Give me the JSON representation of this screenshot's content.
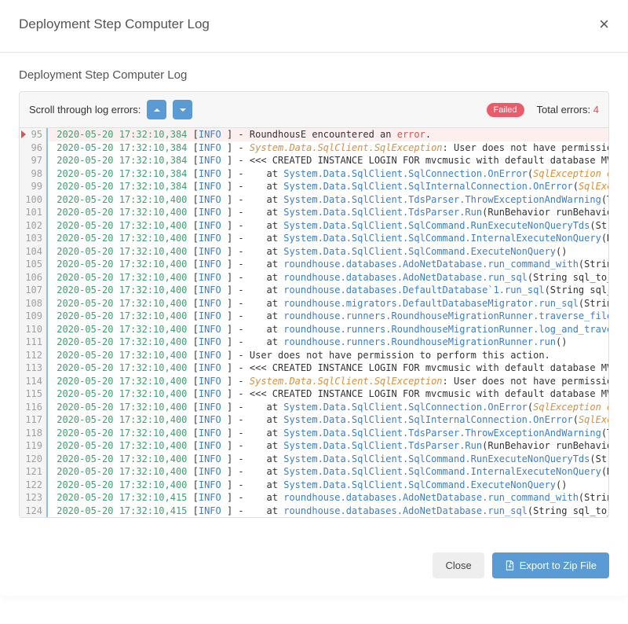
{
  "modal": {
    "title": "Deployment Step Computer Log",
    "close_icon": "×"
  },
  "section": {
    "title": "Deployment Step Computer Log"
  },
  "toolbar": {
    "scroll_label": "Scroll through log errors:",
    "status_badge": "Failed",
    "total_label": "Total errors: ",
    "total_count": "4"
  },
  "footer": {
    "close_label": "Close",
    "export_label": "Export to Zip File"
  },
  "log": {
    "first_line_no": 95,
    "lines": [
      {
        "ts": "2020-05-20 17:32:10,384",
        "lvl": "INFO",
        "msg_parts": [
          [
            "plain",
            " ] - RoundhousE encountered an "
          ],
          [
            "err",
            "error"
          ],
          [
            "plain",
            "."
          ]
        ],
        "current": true
      },
      {
        "ts": "2020-05-20 17:32:10,384",
        "lvl": "INFO",
        "msg_parts": [
          [
            "plain",
            " ] - "
          ],
          [
            "exc",
            "System.Data.SqlClient.SqlException"
          ],
          [
            "plain",
            ": User does not have permission "
          ]
        ]
      },
      {
        "ts": "2020-05-20 17:32:10,384",
        "lvl": "INFO",
        "msg_parts": [
          [
            "plain",
            " ] - <<< CREATED INSTANCE LOGIN FOR mvcmusic with default database MVCM"
          ]
        ]
      },
      {
        "ts": "2020-05-20 17:32:10,384",
        "lvl": "INFO",
        "msg_parts": [
          [
            "plain",
            " ] -    at "
          ],
          [
            "sys",
            "System.Data.SqlClient.SqlConnection.OnError"
          ],
          [
            "plain",
            "("
          ],
          [
            "exc",
            "SqlException exc"
          ]
        ]
      },
      {
        "ts": "2020-05-20 17:32:10,384",
        "lvl": "INFO",
        "msg_parts": [
          [
            "plain",
            " ] -    at "
          ],
          [
            "sys",
            "System.Data.SqlClient.SqlInternalConnection.OnError"
          ],
          [
            "plain",
            "("
          ],
          [
            "exc",
            "SqlExcep"
          ]
        ]
      },
      {
        "ts": "2020-05-20 17:32:10,400",
        "lvl": "INFO",
        "msg_parts": [
          [
            "plain",
            " ] -    at "
          ],
          [
            "sys",
            "System.Data.SqlClient.TdsParser.ThrowExceptionAndWarning"
          ],
          [
            "plain",
            "(Tds"
          ]
        ]
      },
      {
        "ts": "2020-05-20 17:32:10,400",
        "lvl": "INFO",
        "msg_parts": [
          [
            "plain",
            " ] -    at "
          ],
          [
            "sys",
            "System.Data.SqlClient.TdsParser.Run"
          ],
          [
            "plain",
            "(RunBehavior runBehavior,"
          ]
        ]
      },
      {
        "ts": "2020-05-20 17:32:10,400",
        "lvl": "INFO",
        "msg_parts": [
          [
            "plain",
            " ] -    at "
          ],
          [
            "sys",
            "System.Data.SqlClient.SqlCommand.RunExecuteNonQueryTds"
          ],
          [
            "plain",
            "(Strin"
          ]
        ]
      },
      {
        "ts": "2020-05-20 17:32:10,400",
        "lvl": "INFO",
        "msg_parts": [
          [
            "plain",
            " ] -    at "
          ],
          [
            "sys",
            "System.Data.SqlClient.SqlCommand.InternalExecuteNonQuery"
          ],
          [
            "plain",
            "(DbA"
          ]
        ]
      },
      {
        "ts": "2020-05-20 17:32:10,400",
        "lvl": "INFO",
        "msg_parts": [
          [
            "plain",
            " ] -    at "
          ],
          [
            "sys",
            "System.Data.SqlClient.SqlCommand.ExecuteNonQuery"
          ],
          [
            "plain",
            "()"
          ]
        ]
      },
      {
        "ts": "2020-05-20 17:32:10,400",
        "lvl": "INFO",
        "msg_parts": [
          [
            "plain",
            " ] -    at "
          ],
          [
            "sys",
            "roundhouse.databases.AdoNetDatabase.run_command_with"
          ],
          [
            "plain",
            "(String "
          ]
        ]
      },
      {
        "ts": "2020-05-20 17:32:10,400",
        "lvl": "INFO",
        "msg_parts": [
          [
            "plain",
            " ] -    at "
          ],
          [
            "sys",
            "roundhouse.databases.AdoNetDatabase.run_sql"
          ],
          [
            "plain",
            "(String sql_to_ru"
          ]
        ]
      },
      {
        "ts": "2020-05-20 17:32:10,400",
        "lvl": "INFO",
        "msg_parts": [
          [
            "plain",
            " ] -    at "
          ],
          [
            "sys",
            "roundhouse.databases.DefaultDatabase`1.run_sql"
          ],
          [
            "plain",
            "(String sql_to"
          ]
        ]
      },
      {
        "ts": "2020-05-20 17:32:10,400",
        "lvl": "INFO",
        "msg_parts": [
          [
            "plain",
            " ] -    at "
          ],
          [
            "sys",
            "roundhouse.migrators.DefaultDatabaseMigrator.run_sql"
          ],
          [
            "plain",
            "(String "
          ]
        ]
      },
      {
        "ts": "2020-05-20 17:32:10,400",
        "lvl": "INFO",
        "msg_parts": [
          [
            "plain",
            " ] -    at "
          ],
          [
            "sys",
            "roundhouse.runners.RoundhouseMigrationRunner.traverse_files_"
          ]
        ]
      },
      {
        "ts": "2020-05-20 17:32:10,400",
        "lvl": "INFO",
        "msg_parts": [
          [
            "plain",
            " ] -    at "
          ],
          [
            "sys",
            "roundhouse.runners.RoundhouseMigrationRunner.log_and_travers"
          ]
        ]
      },
      {
        "ts": "2020-05-20 17:32:10,400",
        "lvl": "INFO",
        "msg_parts": [
          [
            "plain",
            " ] -    at "
          ],
          [
            "sys",
            "roundhouse.runners.RoundhouseMigrationRunner.run"
          ],
          [
            "plain",
            "()"
          ]
        ]
      },
      {
        "ts": "2020-05-20 17:32:10,400",
        "lvl": "INFO",
        "msg_parts": [
          [
            "plain",
            " ] - User does not have permission to perform this action."
          ]
        ]
      },
      {
        "ts": "2020-05-20 17:32:10,400",
        "lvl": "INFO",
        "msg_parts": [
          [
            "plain",
            " ] - <<< CREATED INSTANCE LOGIN FOR mvcmusic with default database MVCM"
          ]
        ]
      },
      {
        "ts": "2020-05-20 17:32:10,400",
        "lvl": "INFO",
        "msg_parts": [
          [
            "plain",
            " ] - "
          ],
          [
            "exc",
            "System.Data.SqlClient.SqlException"
          ],
          [
            "plain",
            ": User does not have permission "
          ]
        ]
      },
      {
        "ts": "2020-05-20 17:32:10,400",
        "lvl": "INFO",
        "msg_parts": [
          [
            "plain",
            " ] - <<< CREATED INSTANCE LOGIN FOR mvcmusic with default database MVCM"
          ]
        ]
      },
      {
        "ts": "2020-05-20 17:32:10,400",
        "lvl": "INFO",
        "msg_parts": [
          [
            "plain",
            " ] -    at "
          ],
          [
            "sys",
            "System.Data.SqlClient.SqlConnection.OnError"
          ],
          [
            "plain",
            "("
          ],
          [
            "exc",
            "SqlException exc"
          ]
        ]
      },
      {
        "ts": "2020-05-20 17:32:10,400",
        "lvl": "INFO",
        "msg_parts": [
          [
            "plain",
            " ] -    at "
          ],
          [
            "sys",
            "System.Data.SqlClient.SqlInternalConnection.OnError"
          ],
          [
            "plain",
            "("
          ],
          [
            "exc",
            "SqlExcep"
          ]
        ]
      },
      {
        "ts": "2020-05-20 17:32:10,400",
        "lvl": "INFO",
        "msg_parts": [
          [
            "plain",
            " ] -    at "
          ],
          [
            "sys",
            "System.Data.SqlClient.TdsParser.ThrowExceptionAndWarning"
          ],
          [
            "plain",
            "(Tds"
          ]
        ]
      },
      {
        "ts": "2020-05-20 17:32:10,400",
        "lvl": "INFO",
        "msg_parts": [
          [
            "plain",
            " ] -    at "
          ],
          [
            "sys",
            "System.Data.SqlClient.TdsParser.Run"
          ],
          [
            "plain",
            "(RunBehavior runBehavior,"
          ]
        ]
      },
      {
        "ts": "2020-05-20 17:32:10,400",
        "lvl": "INFO",
        "msg_parts": [
          [
            "plain",
            " ] -    at "
          ],
          [
            "sys",
            "System.Data.SqlClient.SqlCommand.RunExecuteNonQueryTds"
          ],
          [
            "plain",
            "(Strin"
          ]
        ]
      },
      {
        "ts": "2020-05-20 17:32:10,400",
        "lvl": "INFO",
        "msg_parts": [
          [
            "plain",
            " ] -    at "
          ],
          [
            "sys",
            "System.Data.SqlClient.SqlCommand.InternalExecuteNonQuery"
          ],
          [
            "plain",
            "(DbA"
          ]
        ]
      },
      {
        "ts": "2020-05-20 17:32:10,400",
        "lvl": "INFO",
        "msg_parts": [
          [
            "plain",
            " ] -    at "
          ],
          [
            "sys",
            "System.Data.SqlClient.SqlCommand.ExecuteNonQuery"
          ],
          [
            "plain",
            "()"
          ]
        ]
      },
      {
        "ts": "2020-05-20 17:32:10,415",
        "lvl": "INFO",
        "msg_parts": [
          [
            "plain",
            " ] -    at "
          ],
          [
            "sys",
            "roundhouse.databases.AdoNetDatabase.run_command_with"
          ],
          [
            "plain",
            "(String "
          ]
        ]
      },
      {
        "ts": "2020-05-20 17:32:10,415",
        "lvl": "INFO",
        "msg_parts": [
          [
            "plain",
            " ] -    at "
          ],
          [
            "sys",
            "roundhouse.databases.AdoNetDatabase.run_sql"
          ],
          [
            "plain",
            "(String sql_to_ru"
          ]
        ]
      }
    ]
  }
}
